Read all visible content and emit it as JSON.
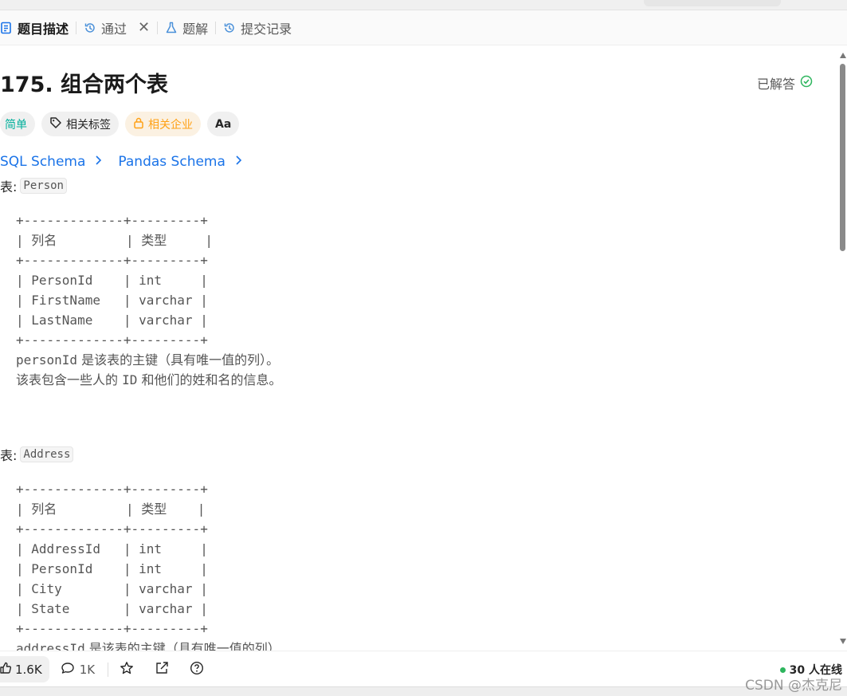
{
  "tabs": [
    {
      "label": "题目描述",
      "icon": "description-icon",
      "active": true
    },
    {
      "label": "通过",
      "icon": "history-icon"
    },
    {
      "label": "题解",
      "icon": "flask-icon"
    },
    {
      "label": "提交记录",
      "icon": "history-icon"
    }
  ],
  "problem": {
    "title": "175. 组合两个表",
    "solved_label": "已解答"
  },
  "tags": {
    "difficulty": "简单",
    "topics": "相关标签",
    "companies": "相关企业",
    "translate": "Aa"
  },
  "schemas": [
    "SQL Schema",
    "Pandas Schema"
  ],
  "tables": [
    {
      "label_prefix": "表:",
      "name": "Person",
      "ascii": "+-------------+---------+\n| 列名         | 类型     |\n+-------------+---------+\n| PersonId    | int     |\n| FirstName   | varchar |\n| LastName    | varchar |\n+-------------+---------+",
      "desc_line1_code": "personId",
      "desc_line1_text": " 是该表的主键（具有唯一值的列）。",
      "desc_line2_a": "该表包含一些人的 ",
      "desc_line2_code": "ID",
      "desc_line2_b": " 和他们的姓和名的信息。"
    },
    {
      "label_prefix": "表:",
      "name": "Address",
      "ascii": "+-------------+---------+\n| 列名         | 类型    |\n+-------------+---------+\n| AddressId   | int     |\n| PersonId    | int     |\n| City        | varchar |\n| State       | varchar |\n+-------------+---------+",
      "desc_line1_code": "addressId",
      "desc_line1_text": " 是该表的主键（具有唯一值的列）"
    }
  ],
  "bottom": {
    "likes": "1.6K",
    "comments": "1K",
    "online": "30 人在线"
  },
  "watermark": "CSDN @杰克尼"
}
